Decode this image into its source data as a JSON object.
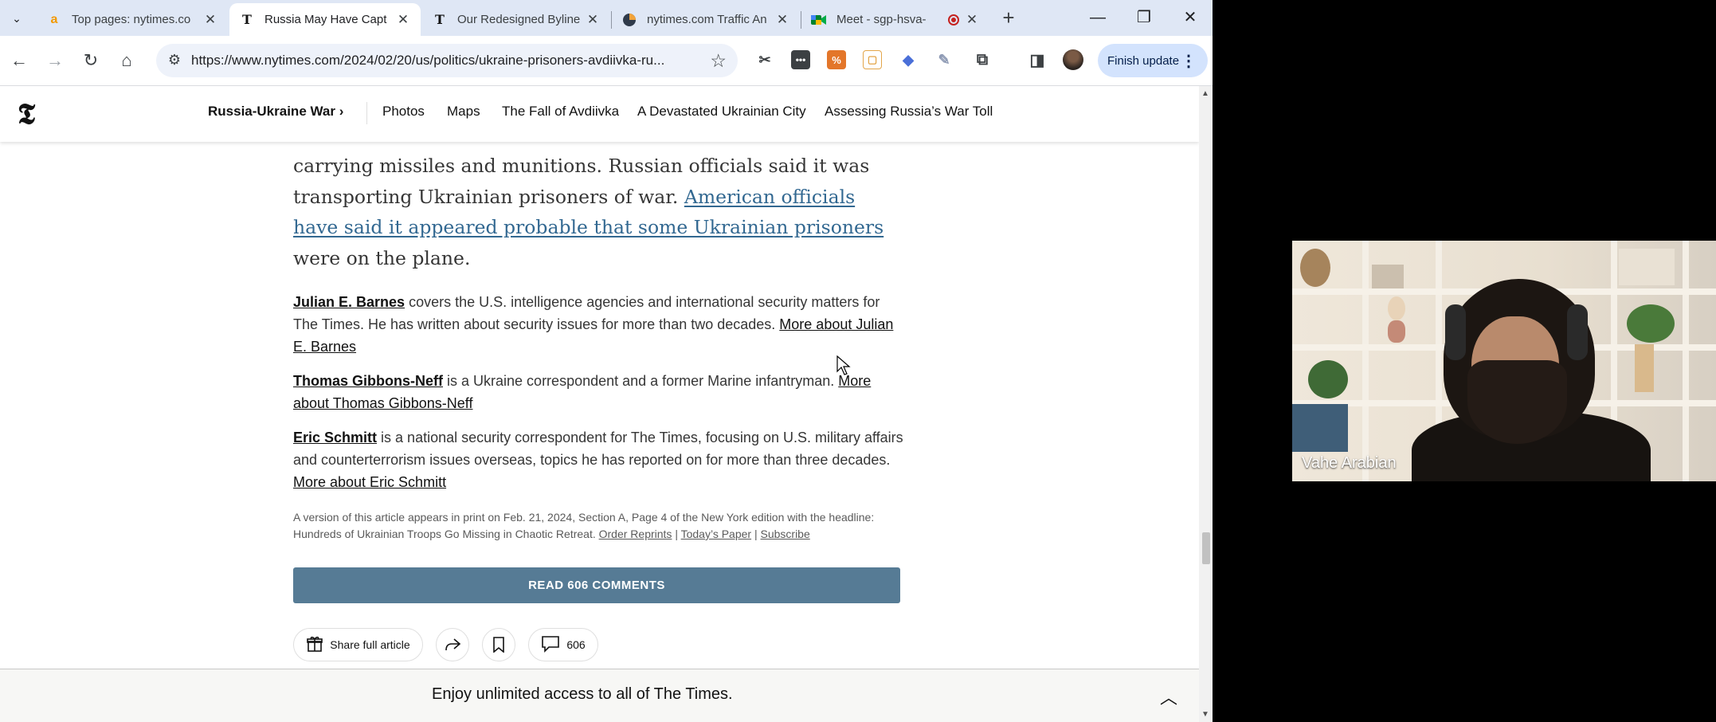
{
  "browser": {
    "tabs": [
      {
        "title": "Top pages: nytimes.co",
        "favicon": "a"
      },
      {
        "title": "Russia May Have Capt",
        "favicon": "T"
      },
      {
        "title": "Our Redesigned Byline",
        "favicon": "T"
      },
      {
        "title": "nytimes.com Traffic An",
        "favicon": "pie-icon"
      },
      {
        "title": "Meet - sgp-hsva-",
        "favicon": "meet-icon"
      }
    ],
    "url": "https://www.nytimes.com/2024/02/20/us/politics/ukraine-prisoners-avdiivka-ru...",
    "finish_update": "Finish update"
  },
  "nyt_nav": {
    "section": "Russia-Ukraine War ›",
    "links": [
      "Photos",
      "Maps",
      "The Fall of Avdiivka",
      "A Devastated Ukrainian City",
      "Assessing Russia’s War Toll"
    ]
  },
  "article": {
    "paragraph_pre": "carrying missiles and munitions. Russian officials said it was transporting Ukrainian prisoners of war.",
    "paragraph_link": "American officials have said it appeared probable that some Ukrainian prisoners",
    "paragraph_post": "were on the plane.",
    "bios": [
      {
        "name": "Julian E. Barnes",
        "text": "covers the U.S. intelligence agencies and international security matters for The Times. He has written about security issues for more than two decades.",
        "more": "More about Julian E. Barnes"
      },
      {
        "name": "Thomas Gibbons-Neff",
        "text": "is a Ukraine correspondent and a former Marine infantryman.",
        "more": "More about Thomas Gibbons-Neff"
      },
      {
        "name": "Eric Schmitt",
        "text": "is a national security correspondent for The Times, focusing on U.S. military affairs and counterterrorism issues overseas, topics he has reported on for more than three decades.",
        "more": "More about Eric Schmitt"
      }
    ],
    "print_note": "A version of this article appears in print on Feb. 21, 2024, Section A, Page 4 of the New York edition with the headline: Hundreds of Ukrainian Troops Go Missing in Chaotic Retreat.",
    "print_links": [
      "Order Reprints",
      "Today’s Paper",
      "Subscribe"
    ],
    "read_comments": "READ 606 COMMENTS",
    "share_label": "Share full article",
    "comment_count": "606"
  },
  "access_bar": {
    "message": "Enjoy unlimited access to all of The Times."
  },
  "video": {
    "participant": "Vahe Arabian"
  },
  "colors": {
    "link": "#326891",
    "comments_button": "#567b95",
    "tabstrip": "#dfe7f5",
    "finish_update": "#d3e3fd"
  }
}
